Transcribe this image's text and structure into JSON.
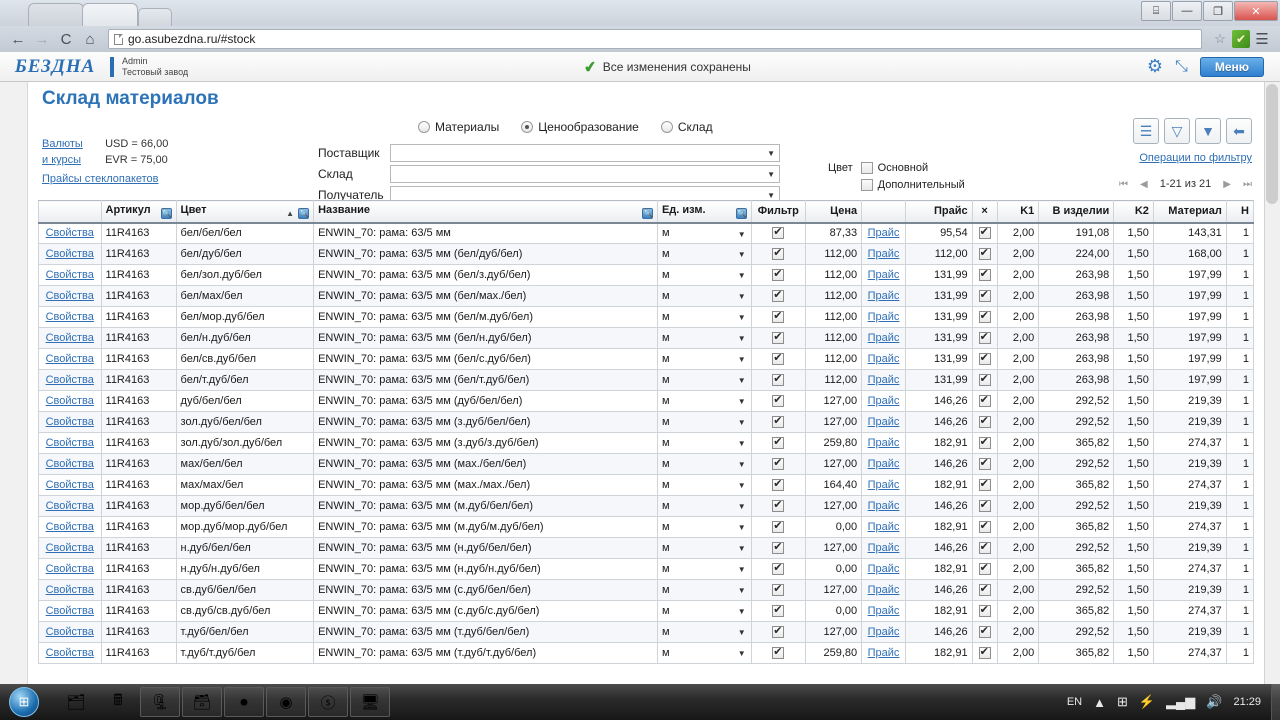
{
  "browser": {
    "tabs": [
      {
        "title": ""
      },
      {
        "title": ""
      }
    ],
    "url": "go.asubezdna.ru/#stock",
    "back_icon": "←",
    "forward_icon": "→",
    "reload_icon": "C",
    "home_icon": "⌂",
    "star_icon": "☆",
    "extension_icon": "✔",
    "menu_icon": "☰",
    "window_minimize": "—",
    "window_maximize": "❐",
    "window_close": "✕",
    "window_user": "⌸"
  },
  "app_header": {
    "logo": "БЕЗДНА",
    "user_name": "Admin",
    "user_org": "Тестовый завод",
    "saved_status": "Все изменения сохранены",
    "gear_icon": "⚙",
    "expand_icon": "⤡",
    "menu_button": "Меню"
  },
  "page": {
    "title": "Склад материалов",
    "currency": {
      "link_line1": "Валюты",
      "link_line2": "и курсы",
      "usd": "USD = 66,00",
      "eur": "EVR = 75,00",
      "glass_link": "Прайсы стеклопакетов"
    },
    "radios": [
      {
        "label": "Материалы",
        "selected": false
      },
      {
        "label": "Ценообразование",
        "selected": true
      },
      {
        "label": "Склад",
        "selected": false
      }
    ],
    "form": [
      {
        "label": "Поставщик",
        "value": ""
      },
      {
        "label": "Склад",
        "value": ""
      },
      {
        "label": "Получатель",
        "value": ""
      }
    ],
    "color_group": {
      "label": "Цвет",
      "options": [
        {
          "label": "Основной",
          "checked": false
        },
        {
          "label": "Дополнительный",
          "checked": false
        }
      ]
    },
    "toolbar_icons": [
      "list-settings-icon",
      "filter-icon",
      "filter-clear-icon",
      "back-arrow-icon"
    ],
    "ops_link": "Операции по фильтру",
    "pager": {
      "first": "⏮",
      "prev": "◀",
      "range": "1-21 из 21",
      "next": "▶",
      "last": "⏭"
    }
  },
  "table": {
    "headers": [
      {
        "label": "",
        "search": false
      },
      {
        "label": "Артикул",
        "search": true
      },
      {
        "label": "Цвет",
        "search": true,
        "sorted": "asc"
      },
      {
        "label": "Название",
        "search": true
      },
      {
        "label": "Ед. изм.",
        "search": true
      },
      {
        "label": "Фильтр",
        "search": false
      },
      {
        "label": "Цена",
        "search": false
      },
      {
        "label": "",
        "search": false
      },
      {
        "label": "Прайс",
        "search": false
      },
      {
        "label": "×",
        "search": false
      },
      {
        "label": "K1",
        "search": false
      },
      {
        "label": "В изделии",
        "search": false
      },
      {
        "label": "K2",
        "search": false
      },
      {
        "label": "Материал",
        "search": false
      },
      {
        "label": "Н",
        "search": false
      }
    ],
    "prop_label": "Свойства",
    "price_link_label": "Прайс",
    "rows": [
      {
        "art": "11R4163",
        "color": "бел/бел/бел",
        "name": "ENWIN_70: рама: 63/5 мм",
        "unit": "м",
        "filter": true,
        "price": "87,33",
        "prais": "95,54",
        "x": true,
        "k1": "2,00",
        "inizd": "191,08",
        "k2": "1,50",
        "mat": "143,31",
        "h": "1"
      },
      {
        "art": "11R4163",
        "color": "бел/дуб/бел",
        "name": "ENWIN_70: рама: 63/5 мм (бел/дуб/бел)",
        "unit": "м",
        "filter": true,
        "price": "112,00",
        "prais": "112,00",
        "x": true,
        "k1": "2,00",
        "inizd": "224,00",
        "k2": "1,50",
        "mat": "168,00",
        "h": "1"
      },
      {
        "art": "11R4163",
        "color": "бел/зол.дуб/бел",
        "name": "ENWIN_70: рама: 63/5 мм (бел/з.дуб/бел)",
        "unit": "м",
        "filter": true,
        "price": "112,00",
        "prais": "131,99",
        "x": true,
        "k1": "2,00",
        "inizd": "263,98",
        "k2": "1,50",
        "mat": "197,99",
        "h": "1"
      },
      {
        "art": "11R4163",
        "color": "бел/мах/бел",
        "name": "ENWIN_70: рама: 63/5 мм (бел/мах./бел)",
        "unit": "м",
        "filter": true,
        "price": "112,00",
        "prais": "131,99",
        "x": true,
        "k1": "2,00",
        "inizd": "263,98",
        "k2": "1,50",
        "mat": "197,99",
        "h": "1"
      },
      {
        "art": "11R4163",
        "color": "бел/мор.дуб/бел",
        "name": "ENWIN_70: рама: 63/5 мм (бел/м.дуб/бел)",
        "unit": "м",
        "filter": true,
        "price": "112,00",
        "prais": "131,99",
        "x": true,
        "k1": "2,00",
        "inizd": "263,98",
        "k2": "1,50",
        "mat": "197,99",
        "h": "1"
      },
      {
        "art": "11R4163",
        "color": "бел/н.дуб/бел",
        "name": "ENWIN_70: рама: 63/5 мм (бел/н.дуб/бел)",
        "unit": "м",
        "filter": true,
        "price": "112,00",
        "prais": "131,99",
        "x": true,
        "k1": "2,00",
        "inizd": "263,98",
        "k2": "1,50",
        "mat": "197,99",
        "h": "1"
      },
      {
        "art": "11R4163",
        "color": "бел/св.дуб/бел",
        "name": "ENWIN_70: рама: 63/5 мм (бел/с.дуб/бел)",
        "unit": "м",
        "filter": true,
        "price": "112,00",
        "prais": "131,99",
        "x": true,
        "k1": "2,00",
        "inizd": "263,98",
        "k2": "1,50",
        "mat": "197,99",
        "h": "1"
      },
      {
        "art": "11R4163",
        "color": "бел/т.дуб/бел",
        "name": "ENWIN_70: рама: 63/5 мм (бел/т.дуб/бел)",
        "unit": "м",
        "filter": true,
        "price": "112,00",
        "prais": "131,99",
        "x": true,
        "k1": "2,00",
        "inizd": "263,98",
        "k2": "1,50",
        "mat": "197,99",
        "h": "1"
      },
      {
        "art": "11R4163",
        "color": "дуб/бел/бел",
        "name": "ENWIN_70: рама: 63/5 мм (дуб/бел/бел)",
        "unit": "м",
        "filter": true,
        "price": "127,00",
        "prais": "146,26",
        "x": true,
        "k1": "2,00",
        "inizd": "292,52",
        "k2": "1,50",
        "mat": "219,39",
        "h": "1"
      },
      {
        "art": "11R4163",
        "color": "зол.дуб/бел/бел",
        "name": "ENWIN_70: рама: 63/5 мм (з.дуб/бел/бел)",
        "unit": "м",
        "filter": true,
        "price": "127,00",
        "prais": "146,26",
        "x": true,
        "k1": "2,00",
        "inizd": "292,52",
        "k2": "1,50",
        "mat": "219,39",
        "h": "1"
      },
      {
        "art": "11R4163",
        "color": "зол.дуб/зол.дуб/бел",
        "name": "ENWIN_70: рама: 63/5 мм (з.дуб/з.дуб/бел)",
        "unit": "м",
        "filter": true,
        "price": "259,80",
        "prais": "182,91",
        "x": true,
        "k1": "2,00",
        "inizd": "365,82",
        "k2": "1,50",
        "mat": "274,37",
        "h": "1"
      },
      {
        "art": "11R4163",
        "color": "мах/бел/бел",
        "name": "ENWIN_70: рама: 63/5 мм (мах./бел/бел)",
        "unit": "м",
        "filter": true,
        "price": "127,00",
        "prais": "146,26",
        "x": true,
        "k1": "2,00",
        "inizd": "292,52",
        "k2": "1,50",
        "mat": "219,39",
        "h": "1"
      },
      {
        "art": "11R4163",
        "color": "мах/мах/бел",
        "name": "ENWIN_70: рама: 63/5 мм (мах./мах./бел)",
        "unit": "м",
        "filter": true,
        "price": "164,40",
        "prais": "182,91",
        "x": true,
        "k1": "2,00",
        "inizd": "365,82",
        "k2": "1,50",
        "mat": "274,37",
        "h": "1"
      },
      {
        "art": "11R4163",
        "color": "мор.дуб/бел/бел",
        "name": "ENWIN_70: рама: 63/5 мм (м.дуб/бел/бел)",
        "unit": "м",
        "filter": true,
        "price": "127,00",
        "prais": "146,26",
        "x": true,
        "k1": "2,00",
        "inizd": "292,52",
        "k2": "1,50",
        "mat": "219,39",
        "h": "1"
      },
      {
        "art": "11R4163",
        "color": "мор.дуб/мор.дуб/бел",
        "name": "ENWIN_70: рама: 63/5 мм (м.дуб/м.дуб/бел)",
        "unit": "м",
        "filter": true,
        "price": "0,00",
        "prais": "182,91",
        "x": true,
        "k1": "2,00",
        "inizd": "365,82",
        "k2": "1,50",
        "mat": "274,37",
        "h": "1"
      },
      {
        "art": "11R4163",
        "color": "н.дуб/бел/бел",
        "name": "ENWIN_70: рама: 63/5 мм (н.дуб/бел/бел)",
        "unit": "м",
        "filter": true,
        "price": "127,00",
        "prais": "146,26",
        "x": true,
        "k1": "2,00",
        "inizd": "292,52",
        "k2": "1,50",
        "mat": "219,39",
        "h": "1"
      },
      {
        "art": "11R4163",
        "color": "н.дуб/н.дуб/бел",
        "name": "ENWIN_70: рама: 63/5 мм (н.дуб/н.дуб/бел)",
        "unit": "м",
        "filter": true,
        "price": "0,00",
        "prais": "182,91",
        "x": true,
        "k1": "2,00",
        "inizd": "365,82",
        "k2": "1,50",
        "mat": "274,37",
        "h": "1"
      },
      {
        "art": "11R4163",
        "color": "св.дуб/бел/бел",
        "name": "ENWIN_70: рама: 63/5 мм (с.дуб/бел/бел)",
        "unit": "м",
        "filter": true,
        "price": "127,00",
        "prais": "146,26",
        "x": true,
        "k1": "2,00",
        "inizd": "292,52",
        "k2": "1,50",
        "mat": "219,39",
        "h": "1"
      },
      {
        "art": "11R4163",
        "color": "св.дуб/св.дуб/бел",
        "name": "ENWIN_70: рама: 63/5 мм (с.дуб/с.дуб/бел)",
        "unit": "м",
        "filter": true,
        "price": "0,00",
        "prais": "182,91",
        "x": true,
        "k1": "2,00",
        "inizd": "365,82",
        "k2": "1,50",
        "mat": "274,37",
        "h": "1"
      },
      {
        "art": "11R4163",
        "color": "т.дуб/бел/бел",
        "name": "ENWIN_70: рама: 63/5 мм (т.дуб/бел/бел)",
        "unit": "м",
        "filter": true,
        "price": "127,00",
        "prais": "146,26",
        "x": true,
        "k1": "2,00",
        "inizd": "292,52",
        "k2": "1,50",
        "mat": "219,39",
        "h": "1"
      },
      {
        "art": "11R4163",
        "color": "т.дуб/т.дуб/бел",
        "name": "ENWIN_70: рама: 63/5 мм (т.дуб/т.дуб/бел)",
        "unit": "м",
        "filter": true,
        "price": "259,80",
        "prais": "182,91",
        "x": true,
        "k1": "2,00",
        "inizd": "365,82",
        "k2": "1,50",
        "mat": "274,37",
        "h": "1"
      }
    ]
  },
  "taskbar": {
    "start_icon": "⊞",
    "items": [
      "folder-icon",
      "calculator-icon",
      "archive-icon",
      "media-icon",
      "player-icon",
      "chrome-icon",
      "skype-icon",
      "remote-icon"
    ],
    "tray": {
      "language": "EN",
      "chevron": "▲",
      "windows_icon": "⊞",
      "plug_icon": "⚡",
      "network_icon": "▂▄▆",
      "volume_icon": "🔊",
      "clock": "21:29"
    }
  }
}
